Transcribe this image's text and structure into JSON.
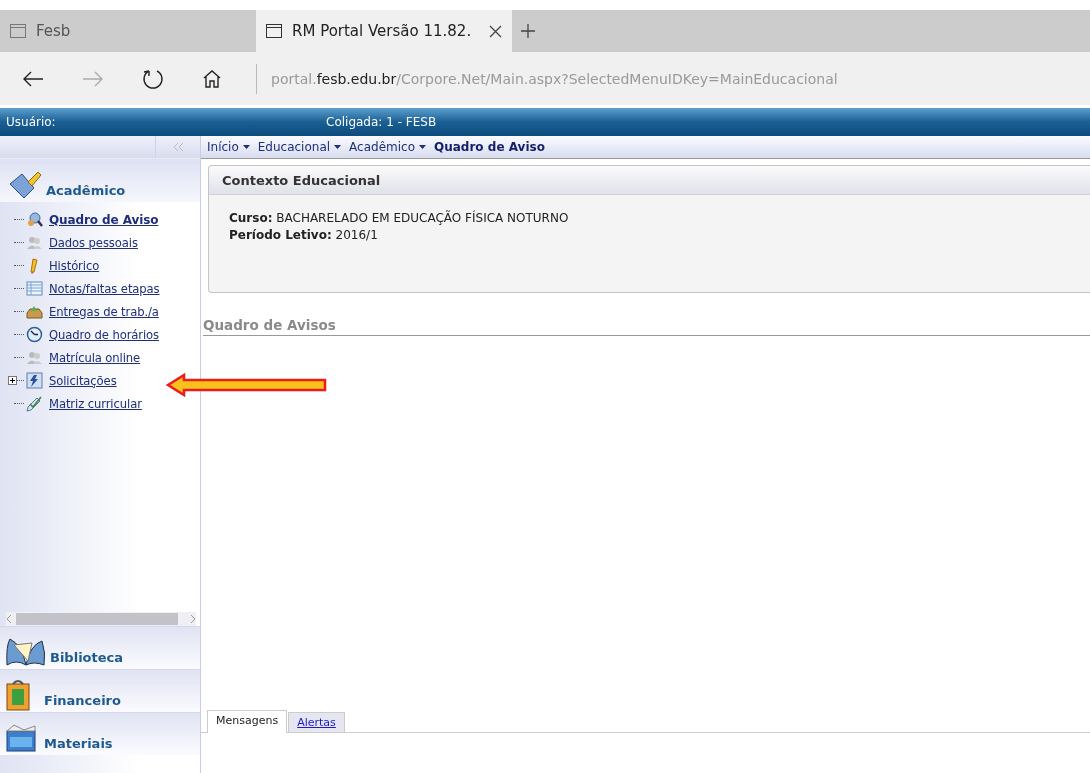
{
  "browser": {
    "tabs": [
      {
        "title": "Fesb",
        "selected": false
      },
      {
        "title": "RM Portal Versão 11.82.",
        "selected": true
      }
    ],
    "address": {
      "prefix": "portal.",
      "domain": "fesb.edu.br",
      "path": "/Corpore.Net/Main.aspx?SelectedMenuIDKey=MainEducacional"
    }
  },
  "header": {
    "user_label": "Usuário:",
    "company": "Coligada: 1 - FESB"
  },
  "breadcrumb": [
    {
      "label": "Início",
      "kind": "menu"
    },
    {
      "label": "Educacional",
      "kind": "menu"
    },
    {
      "label": "Acadêmico",
      "kind": "menu"
    },
    {
      "label": "Quadro de Aviso",
      "kind": "current"
    }
  ],
  "sidebar": {
    "section": "Acadêmico",
    "items": [
      {
        "label": "Quadro de Aviso",
        "selected": true,
        "expandable": false
      },
      {
        "label": "Dados pessoais",
        "selected": false,
        "expandable": false
      },
      {
        "label": "Histórico",
        "selected": false,
        "expandable": false
      },
      {
        "label": "Notas/faltas etapas",
        "selected": false,
        "expandable": false
      },
      {
        "label": "Entregas de trab./a",
        "selected": false,
        "expandable": false
      },
      {
        "label": "Quadro de horários",
        "selected": false,
        "expandable": false
      },
      {
        "label": "Matrícula online",
        "selected": false,
        "expandable": false
      },
      {
        "label": "Solicitações",
        "selected": false,
        "expandable": true
      },
      {
        "label": "Matriz curricular",
        "selected": false,
        "expandable": false
      }
    ],
    "modules": [
      "Biblioteca",
      "Financeiro",
      "Materiais"
    ]
  },
  "context": {
    "title": "Contexto Educacional",
    "fields": [
      {
        "label": "Curso:",
        "value": "BACHARELADO EM EDUCAÇÃO FÍSICA NOTURNO"
      },
      {
        "label": "Período Letivo:",
        "value": "2016/1"
      }
    ]
  },
  "notices": {
    "title": "Quadro de Avisos",
    "tabs": [
      {
        "label": "Mensagens",
        "selected": true
      },
      {
        "label": "Alertas",
        "selected": false
      }
    ]
  }
}
